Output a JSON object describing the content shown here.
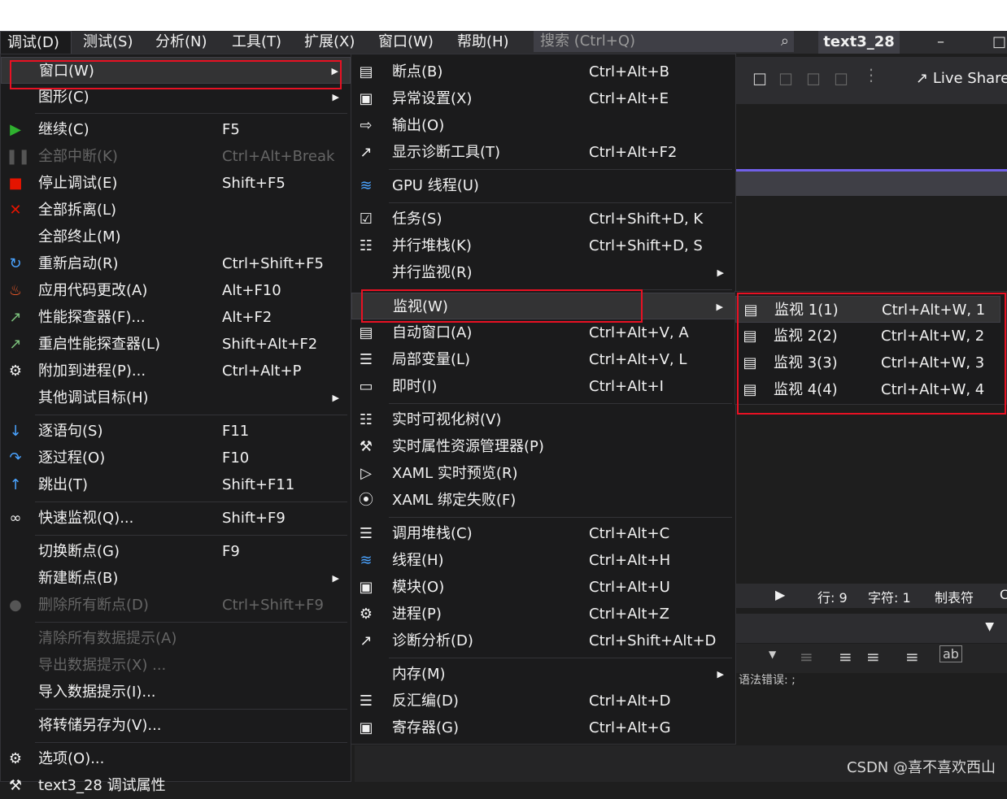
{
  "menubar": {
    "items": [
      "调试(D)",
      "测试(S)",
      "分析(N)",
      "工具(T)",
      "扩展(X)",
      "窗口(W)",
      "帮助(H)"
    ],
    "search_placeholder": "搜索 (Ctrl+Q)",
    "project_name": "text3_28"
  },
  "toolbar": {
    "live_share": "Live Share"
  },
  "statusbar": {
    "line": "行: 9",
    "char": "字符: 1",
    "tab": "制表符",
    "extra": "C"
  },
  "output_fragment": "语法错误: ;",
  "watermark": "CSDN @喜不喜欢西山",
  "debug_menu": [
    {
      "label": "窗口(W)",
      "shortcut": "",
      "submenu": true,
      "highlighted": true,
      "icon": ""
    },
    {
      "label": "图形(C)",
      "shortcut": "",
      "submenu": true,
      "icon": ""
    },
    {
      "label": "继续(C)",
      "shortcut": "F5",
      "icon": "play-icon"
    },
    {
      "label": "全部中断(K)",
      "shortcut": "Ctrl+Alt+Break",
      "disabled": true,
      "icon": "pause-icon"
    },
    {
      "label": "停止调试(E)",
      "shortcut": "Shift+F5",
      "icon": "stop-icon"
    },
    {
      "label": "全部拆离(L)",
      "shortcut": "",
      "icon": "detach-icon"
    },
    {
      "label": "全部终止(M)",
      "shortcut": "",
      "icon": ""
    },
    {
      "label": "重新启动(R)",
      "shortcut": "Ctrl+Shift+F5",
      "icon": "restart-icon"
    },
    {
      "label": "应用代码更改(A)",
      "shortcut": "Alt+F10",
      "icon": "hot-reload-icon"
    },
    {
      "label": "性能探查器(F)...",
      "shortcut": "Alt+F2",
      "icon": "profiler-icon"
    },
    {
      "label": "重启性能探查器(L)",
      "shortcut": "Shift+Alt+F2",
      "icon": "profiler-restart-icon"
    },
    {
      "label": "附加到进程(P)...",
      "shortcut": "Ctrl+Alt+P",
      "icon": "attach-icon"
    },
    {
      "label": "其他调试目标(H)",
      "shortcut": "",
      "submenu": true,
      "icon": ""
    },
    {
      "label": "逐语句(S)",
      "shortcut": "F11",
      "icon": "step-into-icon"
    },
    {
      "label": "逐过程(O)",
      "shortcut": "F10",
      "icon": "step-over-icon"
    },
    {
      "label": "跳出(T)",
      "shortcut": "Shift+F11",
      "icon": "step-out-icon"
    },
    {
      "label": "快速监视(Q)...",
      "shortcut": "Shift+F9",
      "icon": "quickwatch-icon"
    },
    {
      "label": "切换断点(G)",
      "shortcut": "F9",
      "icon": ""
    },
    {
      "label": "新建断点(B)",
      "shortcut": "",
      "submenu": true,
      "icon": ""
    },
    {
      "label": "删除所有断点(D)",
      "shortcut": "Ctrl+Shift+F9",
      "disabled": true,
      "icon": "delete-breakpoints-icon"
    },
    {
      "label": "清除所有数据提示(A)",
      "shortcut": "",
      "disabled": true,
      "icon": ""
    },
    {
      "label": "导出数据提示(X) ...",
      "shortcut": "",
      "disabled": true,
      "icon": ""
    },
    {
      "label": "导入数据提示(I)...",
      "shortcut": "",
      "icon": ""
    },
    {
      "label": "将转储另存为(V)...",
      "shortcut": "",
      "icon": ""
    },
    {
      "label": "选项(O)...",
      "shortcut": "",
      "icon": "gear-icon"
    },
    {
      "label": "text3_28 调试属性",
      "shortcut": "",
      "icon": "wrench-icon"
    }
  ],
  "window_menu": [
    {
      "label": "断点(B)",
      "shortcut": "Ctrl+Alt+B",
      "icon": "breakpoints-window-icon"
    },
    {
      "label": "异常设置(X)",
      "shortcut": "Ctrl+Alt+E",
      "icon": "exception-settings-icon"
    },
    {
      "label": "输出(O)",
      "shortcut": "",
      "icon": "output-icon"
    },
    {
      "label": "显示诊断工具(T)",
      "shortcut": "Ctrl+Alt+F2",
      "icon": "diagnostics-icon"
    },
    {
      "label": "GPU 线程(U)",
      "shortcut": "",
      "icon": "gpu-threads-icon"
    },
    {
      "label": "任务(S)",
      "shortcut": "Ctrl+Shift+D, K",
      "icon": "tasks-icon"
    },
    {
      "label": "并行堆栈(K)",
      "shortcut": "Ctrl+Shift+D, S",
      "icon": "parallel-stacks-icon"
    },
    {
      "label": "并行监视(R)",
      "shortcut": "",
      "submenu": true,
      "icon": ""
    },
    {
      "label": "监视(W)",
      "shortcut": "",
      "submenu": true,
      "highlighted": true,
      "icon": ""
    },
    {
      "label": "自动窗口(A)",
      "shortcut": "Ctrl+Alt+V, A",
      "icon": "autos-icon"
    },
    {
      "label": "局部变量(L)",
      "shortcut": "Ctrl+Alt+V, L",
      "icon": "locals-icon"
    },
    {
      "label": "即时(I)",
      "shortcut": "Ctrl+Alt+I",
      "icon": "immediate-icon"
    },
    {
      "label": "实时可视化树(V)",
      "shortcut": "",
      "icon": "visual-tree-icon"
    },
    {
      "label": "实时属性资源管理器(P)",
      "shortcut": "",
      "icon": "property-explorer-icon"
    },
    {
      "label": "XAML 实时预览(R)",
      "shortcut": "",
      "icon": "xaml-preview-icon"
    },
    {
      "label": "XAML 绑定失败(F)",
      "shortcut": "",
      "icon": "xaml-binding-icon"
    },
    {
      "label": "调用堆栈(C)",
      "shortcut": "Ctrl+Alt+C",
      "icon": "call-stack-icon"
    },
    {
      "label": "线程(H)",
      "shortcut": "Ctrl+Alt+H",
      "icon": "threads-icon"
    },
    {
      "label": "模块(O)",
      "shortcut": "Ctrl+Alt+U",
      "icon": "modules-icon"
    },
    {
      "label": "进程(P)",
      "shortcut": "Ctrl+Alt+Z",
      "icon": "processes-icon"
    },
    {
      "label": "诊断分析(D)",
      "shortcut": "Ctrl+Shift+Alt+D",
      "icon": "diagnostic-analysis-icon"
    },
    {
      "label": "内存(M)",
      "shortcut": "",
      "submenu": true,
      "icon": ""
    },
    {
      "label": "反汇编(D)",
      "shortcut": "Ctrl+Alt+D",
      "icon": "disassembly-icon"
    },
    {
      "label": "寄存器(G)",
      "shortcut": "Ctrl+Alt+G",
      "icon": "registers-icon"
    }
  ],
  "watch_menu": [
    {
      "label": "监视 1(1)",
      "shortcut": "Ctrl+Alt+W, 1",
      "highlighted": true,
      "icon": "watch-icon"
    },
    {
      "label": "监视 2(2)",
      "shortcut": "Ctrl+Alt+W, 2",
      "icon": "watch-icon"
    },
    {
      "label": "监视 3(3)",
      "shortcut": "Ctrl+Alt+W, 3",
      "icon": "watch-icon"
    },
    {
      "label": "监视 4(4)",
      "shortcut": "Ctrl+Alt+W, 4",
      "icon": "watch-icon"
    }
  ],
  "colors": {
    "highlight_box": "#e81123",
    "menu_bg": "#1b1b1c",
    "accent": "#7160e8"
  }
}
